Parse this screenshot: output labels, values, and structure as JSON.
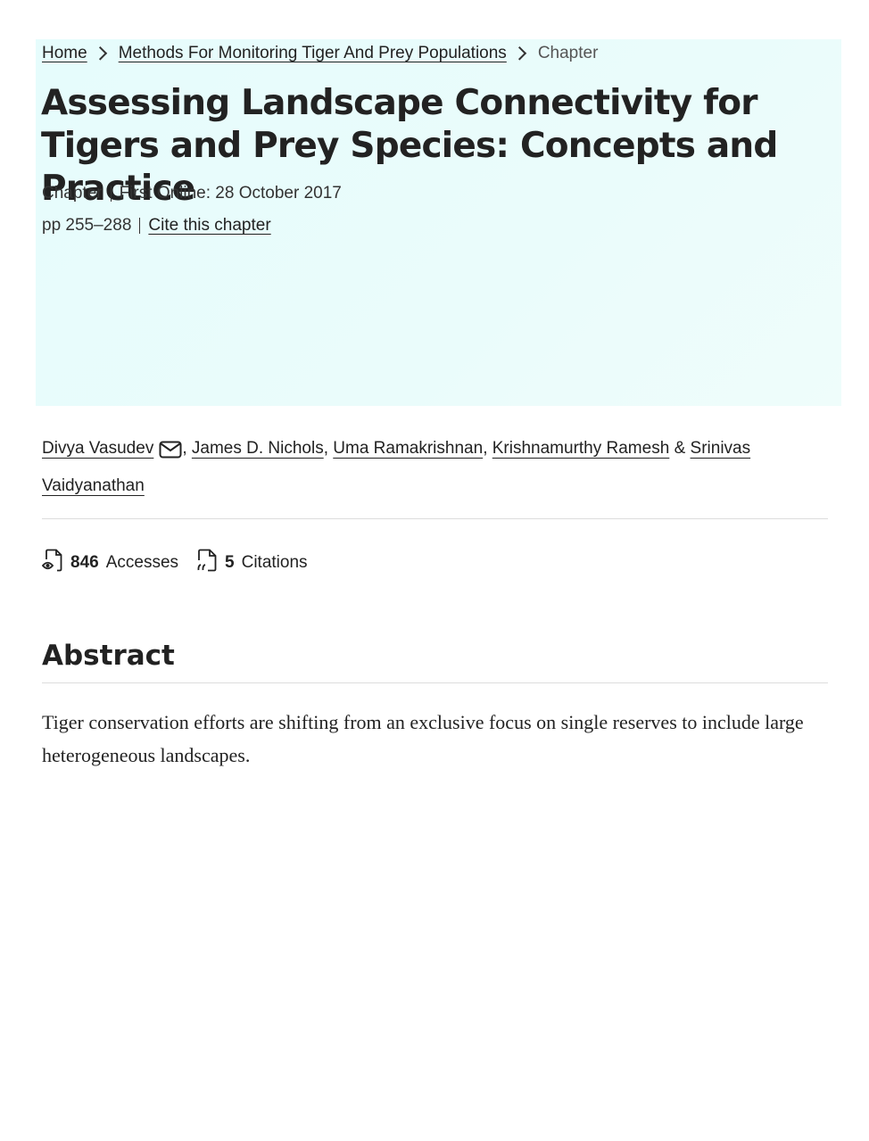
{
  "breadcrumb": {
    "home": "Home",
    "book": "Methods For Monitoring Tiger And Prey Populations",
    "current": "Chapter"
  },
  "title": "Assessing Landscape Connectivity for Tigers and Prey Species: Concepts and Practice",
  "meta": {
    "type": "Chapter",
    "first_online": "First Online: 28 October 2017",
    "pages": "pp 255–288",
    "cite_label": "Cite this chapter"
  },
  "authors": [
    {
      "name": "Divya Vasudev"
    },
    {
      "name": "James D. Nichols"
    },
    {
      "name": "Uma Ramakrishnan"
    },
    {
      "name": "Krishnamurthy Ramesh"
    },
    {
      "name": "Srinivas Vaidyanathan"
    }
  ],
  "author_separators": {
    "comma": ",",
    "and": "&"
  },
  "metrics": {
    "accesses_count": "846",
    "accesses_label": "Accesses",
    "citations_count": "5",
    "citations_label": "Citations"
  },
  "abstract": {
    "heading": "Abstract",
    "text": "Tiger conservation efforts are shifting from an exclusive focus on single reserves to include large heterogeneous landscapes."
  },
  "icons": {
    "chevron": "chevron-right-icon",
    "mail": "mail-icon",
    "accesses": "eye-document-icon",
    "citations": "quote-document-icon"
  }
}
